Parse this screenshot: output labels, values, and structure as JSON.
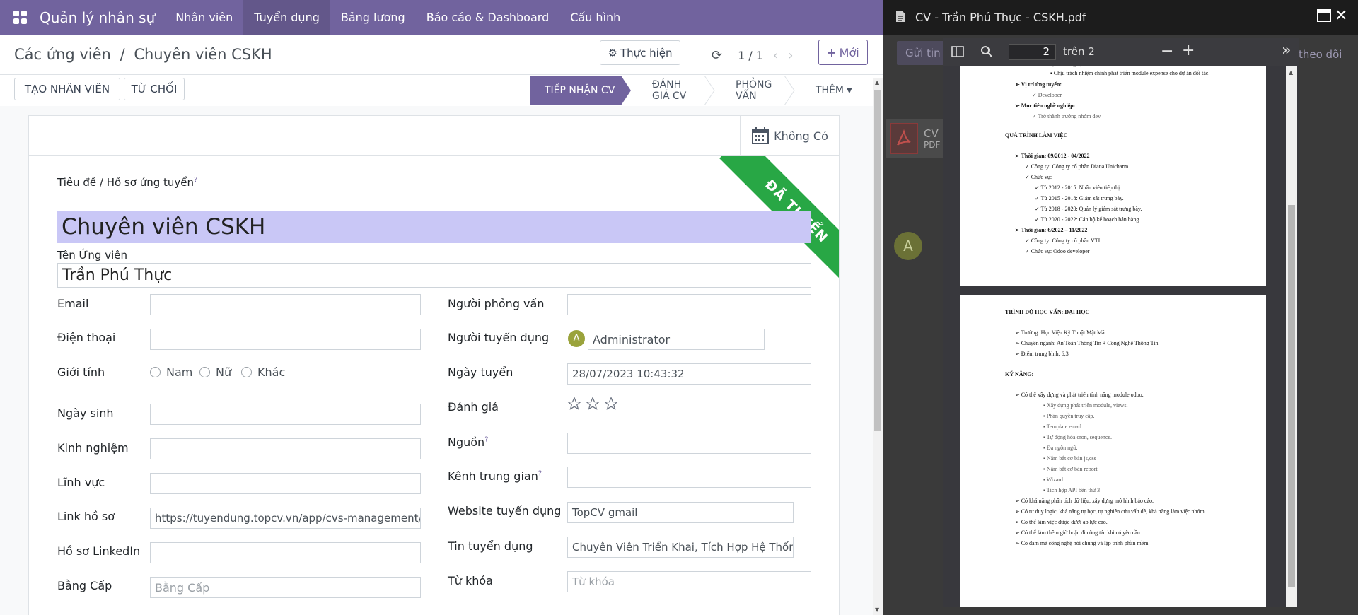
{
  "nav": {
    "app_title": "Quản lý nhân sự",
    "items": [
      {
        "label": "Nhân viên"
      },
      {
        "label": "Tuyển dụng"
      },
      {
        "label": "Bảng lương"
      },
      {
        "label": "Báo cáo & Dashboard"
      },
      {
        "label": "Cấu hình"
      }
    ]
  },
  "breadcrumb": {
    "parent": "Các ứng viên",
    "separator": "/",
    "current": "Chuyên viên CSKH"
  },
  "control": {
    "action_label": "Thực hiện",
    "pager": "1 / 1",
    "new_label": "Mới",
    "create_employee": "TẠO NHÂN VIÊN",
    "refuse": "TỪ CHỐI"
  },
  "stages": [
    "TIẾP NHẬN CV",
    "ĐÁNH GIÁ CV",
    "PHỎNG VẤN",
    "THÊM"
  ],
  "sheet": {
    "smart_button": "Không Có",
    "ribbon": "ĐÃ TUYỂN",
    "title_label": "Tiêu đề / Hồ sơ ứng tuyển",
    "title_value": "Chuyên viên CSKH",
    "name_label": "Tên Ứng viên",
    "name_value": "Trần Phú Thực",
    "left": {
      "email": "Email",
      "phone": "Điện thoại",
      "gender": "Giới tính",
      "gender_options": [
        "Nam",
        "Nữ",
        "Khác"
      ],
      "birthday": "Ngày sinh",
      "experience": "Kinh nghiệm",
      "field": "Lĩnh vực",
      "profile_link": "Link hồ sơ",
      "profile_link_value": "https://tuyendung.topcv.vn/app/cvs-management/c",
      "linkedin": "Hồ sơ LinkedIn",
      "degree": "Bằng Cấp",
      "degree_placeholder": "Bằng Cấp"
    },
    "right": {
      "interviewer": "Người phỏng vấn",
      "recruiter": "Người tuyển dụng",
      "recruiter_value": "Administrator",
      "recruiter_initial": "A",
      "hire_date": "Ngày tuyển",
      "hire_date_value": "28/07/2023 10:43:32",
      "rating": "Đánh giá",
      "rating_value": 0,
      "source": "Nguồn",
      "medium": "Kênh trung gian",
      "website": "Website tuyển dụng",
      "website_value": "TopCV gmail",
      "job_post": "Tin tuyển dụng",
      "job_post_value": "Chuyên Viên Triển Khai, Tích Hợp Hệ Thống",
      "keywords": "Từ khóa",
      "keywords_placeholder": "Từ khóa"
    }
  },
  "chatter": {
    "send_label": "Gửi tin",
    "follow_label": "theo dõi",
    "attachment_name": "CV",
    "attachment_ext": "PDF",
    "avatar_initial": "A"
  },
  "pdf": {
    "title": "CV - Trần Phú Thực - CSKH.pdf",
    "page_current": "2",
    "page_total": "trên 2",
    "page1_lines": [
      "Chịu trách nhiệm chính phát triển module expense cho dự án đối tác.",
      "Vị trí ứng tuyển:",
      "Developer",
      "Mục tiêu nghề nghiệp:",
      "Trở thành trưởng nhóm dev.",
      "QUÁ TRÌNH LÀM VIỆC",
      "Thời gian: 09/2012 - 04/2022",
      "Công ty: Công ty cổ phần Diana Unicharm",
      "Chức vụ:",
      "Từ 2012 - 2015: Nhân viên tiếp thị.",
      "Từ 2015 - 2018: Giám sát trưng bày.",
      "Từ 2018 - 2020: Quản lý giám sát trưng bày.",
      "Từ 2020 - 2022: Cán bộ kế hoạch bán hàng.",
      "Thời gian: 6/2022 – 11/2022",
      "Công ty: Công ty cổ phần VTI",
      "Chức vụ: Odoo developer"
    ],
    "page2_lines": [
      "TRÌNH ĐỘ HỌC VẤN: ĐẠI HỌC",
      "Trường: Học Viện Kỹ Thuật Mật Mã",
      "Chuyên ngành: An Toàn Thông Tin + Công Nghệ Thông Tin",
      "Điểm trung bình: 6,3",
      "KỸ NĂNG:",
      "Có thể xây dựng và phát triển tính năng module odoo:",
      "Xây dựng phát triển module, views.",
      "Phân quyền truy cập.",
      "Template email.",
      "Tự động hóa cron, sequence.",
      "Đa ngôn ngữ.",
      "Nắm bắt cơ bản js,css",
      "Nắm bắt cơ bản report",
      "Wizard",
      "Tích hợp API bên thứ 3",
      "Có khả năng phân tích dữ liệu, xây dựng mô hình báo cáo.",
      "Có tư duy logic, khả năng tự học, tự nghiên cứu vấn đề, khả năng làm việc nhóm",
      "Có thể làm việc được dưới áp lực cao.",
      "Có thể làm thêm giờ hoặc đi công tác khi có yêu cầu.",
      "Có đam mê công nghệ nói chung và lập trình phần mềm."
    ]
  }
}
